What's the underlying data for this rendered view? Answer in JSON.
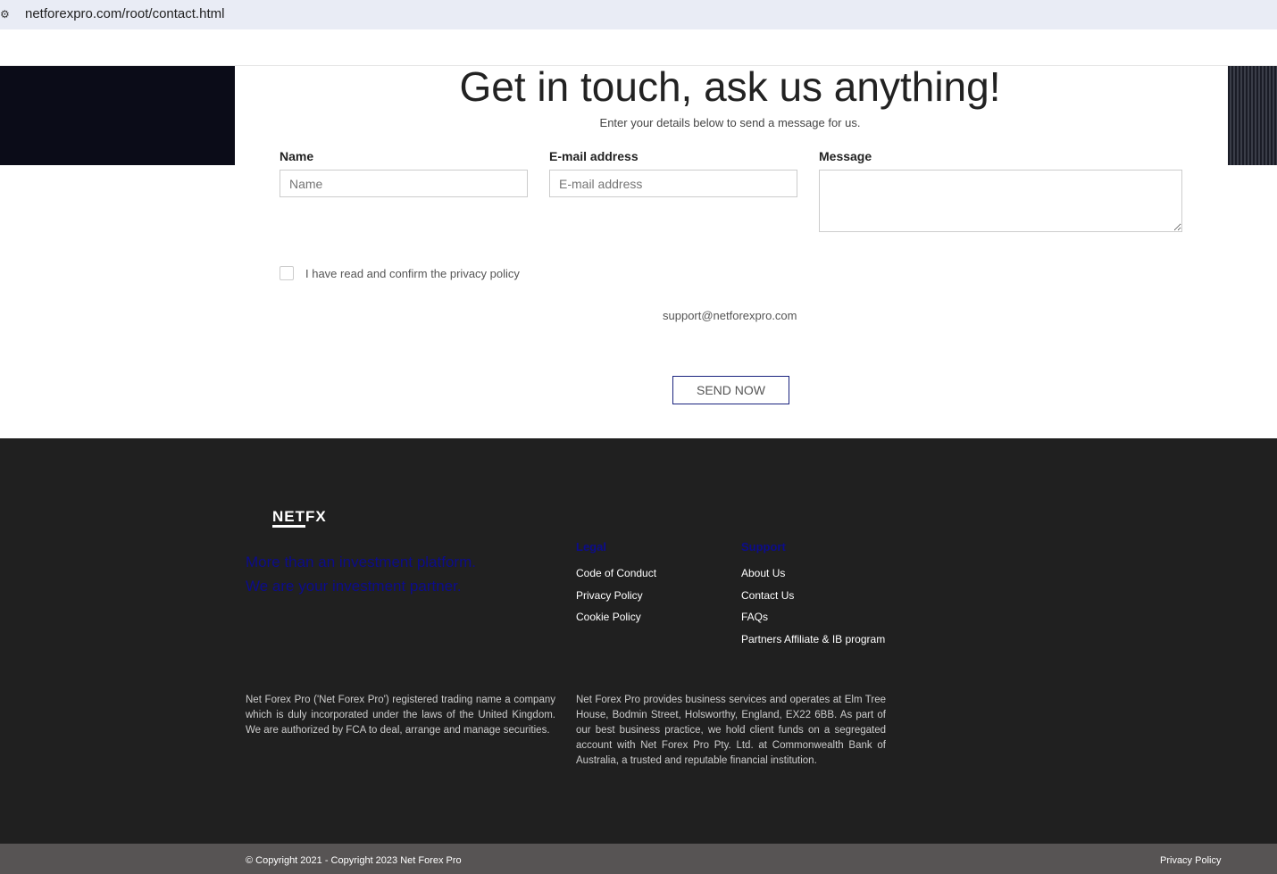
{
  "browser": {
    "url": "netforexpro.com/root/contact.html"
  },
  "contact": {
    "title": "Get in touch, ask us anything!",
    "subtitle": "Enter your details below to send a message for us.",
    "name_label": "Name",
    "name_placeholder": "Name",
    "email_label": "E-mail address",
    "email_placeholder": "E-mail address",
    "message_label": "Message",
    "privacy_text": "I have read and confirm the privacy policy",
    "support_email": "support@netforexpro.com",
    "send_label": "SEND NOW"
  },
  "footer": {
    "logo": "NETFX",
    "tagline1": "More than an investment platform.",
    "tagline2": "We are your investment partner.",
    "legal_heading": "Legal",
    "legal_links": [
      "Code of Conduct",
      "Privacy Policy",
      "Cookie Policy"
    ],
    "support_heading": "Support",
    "support_links": [
      "About Us",
      "Contact Us",
      "FAQs",
      "Partners Affiliate & IB program"
    ],
    "disclaimer1": "Net Forex Pro ('Net Forex Pro') registered trading name a company which is duly incorporated under the laws of the United Kingdom. We are authorized by FCA to deal, arrange and manage securities.",
    "disclaimer2": "Net Forex Pro provides business services and operates at Elm Tree House, Bodmin Street, Holsworthy, England, EX22 6BB. As part of our best business practice, we hold client funds on a segregated account with Net Forex Pro Pty. Ltd. at Commonwealth Bank of Australia, a trusted and reputable financial institution.",
    "copyright": "© Copyright 2021 - Copyright 2023 Net Forex Pro",
    "privacy_link": "Privacy Policy"
  }
}
